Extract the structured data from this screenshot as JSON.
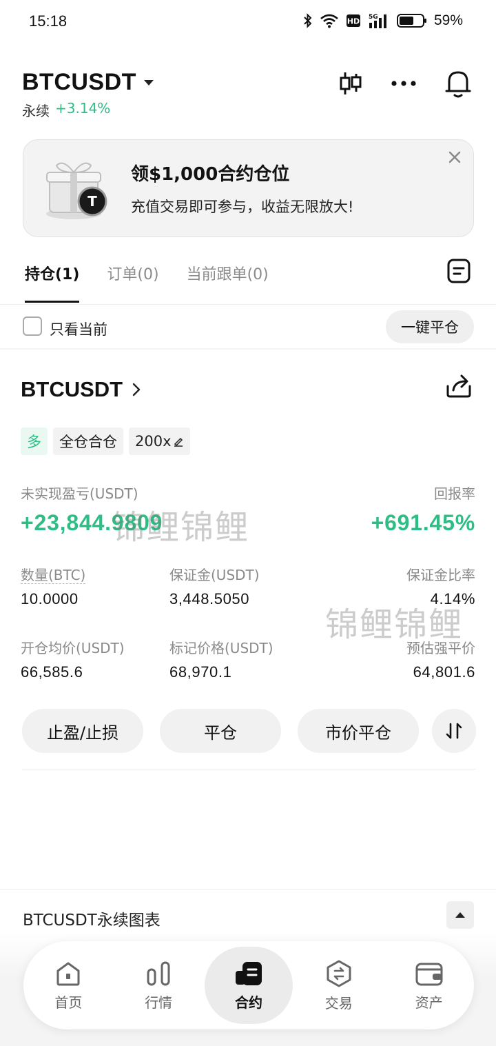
{
  "status_bar": {
    "time": "15:18",
    "battery": "59%",
    "icons": [
      "bluetooth-icon",
      "wifi-icon",
      "hd-icon",
      "5g-signal-icon",
      "battery-icon"
    ]
  },
  "header": {
    "symbol": "BTCUSDT",
    "type": "永续",
    "change": "+3.14%"
  },
  "banner": {
    "title": "领$1,000合约仓位",
    "description": "充值交易即可参与，收益无限放大!"
  },
  "tabs": [
    {
      "label": "持仓(1)",
      "active": true
    },
    {
      "label": "订单(0)",
      "active": false
    },
    {
      "label": "当前跟单(0)",
      "active": false
    }
  ],
  "filter": {
    "only_current": "只看当前",
    "close_all": "一键平仓"
  },
  "position": {
    "symbol": "BTCUSDT",
    "side": "多",
    "margin_mode": "全仓合仓",
    "leverage": "200x",
    "pnl_label": "未实现盈亏(USDT)",
    "pnl_value": "+23,844.9809",
    "roe_label": "回报率",
    "roe_value": "+691.45%",
    "qty_label": "数量(BTC)",
    "qty_value": "10.0000",
    "margin_label": "保证金(USDT)",
    "margin_value": "3,448.5050",
    "margin_ratio_label": "保证金比率",
    "margin_ratio_value": "4.14%",
    "entry_label": "开仓均价(USDT)",
    "entry_value": "66,585.6",
    "mark_label": "标记价格(USDT)",
    "mark_value": "68,970.1",
    "liq_label": "预估强平价",
    "liq_value": "64,801.6",
    "watermark": "锦鲤锦鲤"
  },
  "actions": {
    "tpsl": "止盈/止损",
    "close": "平仓",
    "market_close": "市价平仓"
  },
  "chart": {
    "title": "BTCUSDT永续图表"
  },
  "nav": [
    {
      "label": "首页",
      "icon": "home-icon",
      "active": false
    },
    {
      "label": "行情",
      "icon": "markets-icon",
      "active": false
    },
    {
      "label": "合约",
      "icon": "futures-icon",
      "active": true
    },
    {
      "label": "交易",
      "icon": "trade-icon",
      "active": false
    },
    {
      "label": "资产",
      "icon": "wallet-icon",
      "active": false
    }
  ],
  "colors": {
    "green": "#2ebd85",
    "text": "#121212",
    "muted": "#8a8a8a"
  }
}
